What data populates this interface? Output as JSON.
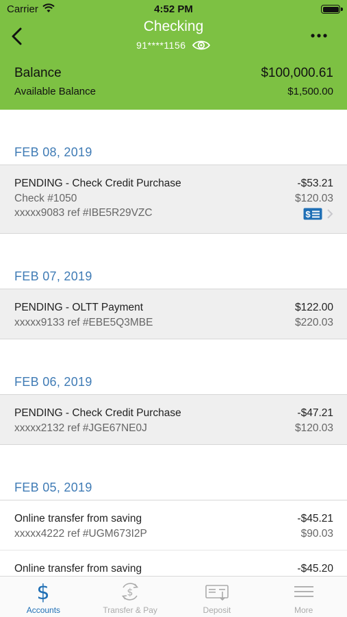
{
  "status_bar": {
    "carrier": "Carrier",
    "time": "4:52 PM"
  },
  "header": {
    "title": "Checking",
    "account_number": "91****1156",
    "balance_label": "Balance",
    "balance_value": "$100,000.61",
    "available_label": "Available Balance",
    "available_value": "$1,500.00"
  },
  "colors": {
    "header_bg": "#7dc143",
    "date_text": "#3f7bb5",
    "active_tab": "#1f6fb5",
    "pending_row_bg": "#efefef"
  },
  "groups": [
    {
      "date": "FEB 08, 2019",
      "transactions": [
        {
          "description": "PENDING - Check Credit Purchase",
          "check": "Check #1050",
          "reference": "xxxxx9083 ref #IBE5R29VZC",
          "amount": "-$53.21",
          "balance": "$120.03",
          "has_check_image": true
        }
      ]
    },
    {
      "date": "FEB 07, 2019",
      "transactions": [
        {
          "description": "PENDING - OLTT Payment",
          "reference": "xxxxx9133 ref #EBE5Q3MBE",
          "amount": "$122.00",
          "balance": "$220.03"
        }
      ]
    },
    {
      "date": "FEB 06, 2019",
      "transactions": [
        {
          "description": "PENDING - Check Credit Purchase",
          "reference": "xxxxx2132 ref #JGE67NE0J",
          "amount": "-$47.21",
          "balance": "$120.03"
        }
      ]
    },
    {
      "date": "FEB 05, 2019",
      "transactions": [
        {
          "description": "Online transfer from saving",
          "reference": "xxxxx4222 ref #UGM673I2P",
          "amount": "-$45.21",
          "balance": "$90.03"
        },
        {
          "description": "Online transfer from saving",
          "amount": "-$45.20"
        }
      ]
    }
  ],
  "tabs": [
    {
      "label": "Accounts",
      "icon": "dollar-icon",
      "active": true
    },
    {
      "label": "Transfer & Pay",
      "icon": "transfer-pay-icon",
      "active": false
    },
    {
      "label": "Deposit",
      "icon": "deposit-check-icon",
      "active": false
    },
    {
      "label": "More",
      "icon": "hamburger-menu-icon",
      "active": false
    }
  ]
}
